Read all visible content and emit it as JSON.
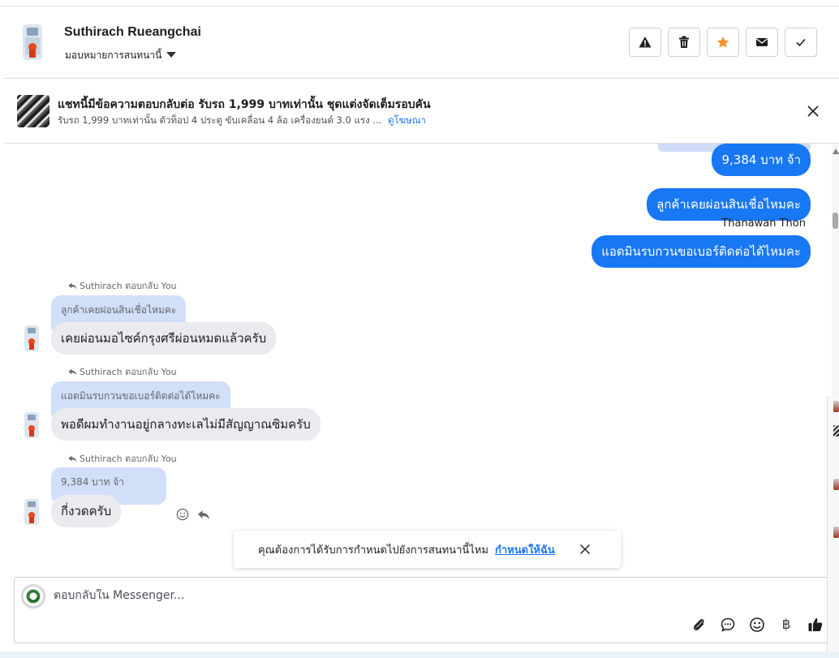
{
  "header": {
    "contact_name": "Suthirach Rueangchai",
    "assign_label": "มอบหมายการสนทนานี้",
    "actions": [
      {
        "name": "report-button",
        "icon": "warning-icon"
      },
      {
        "name": "delete-button",
        "icon": "trash-icon"
      },
      {
        "name": "star-button",
        "icon": "star-icon",
        "color": "#f0932b"
      },
      {
        "name": "mark-unread-button",
        "icon": "envelope-icon"
      },
      {
        "name": "mark-done-button",
        "icon": "check-icon"
      }
    ]
  },
  "ad_banner": {
    "title": "แชทนี้มีข้อความตอบกลับต่อ รับรถ 1,999 บาทเท่านั้น ชุดแต่งจัดเต็มรอบคัน",
    "subtitle": "รับรถ 1,999 บาทเท่านั้น ตัวท็อป 4 ประตู ขับเคลื่อน 4 ล้อ เครื่องยนต์ 3.0 แรง ...",
    "link": "ดูโฆษณา"
  },
  "conversation": {
    "outgoing": [
      {
        "text": "9,384 บาท จ้า"
      },
      {
        "text": "ลูกค้าเคยผ่อนสินเชื่อไหมคะ"
      },
      {
        "text": "แอดมินรบกวนขอเบอร์ติดต่อได้ไหมคะ"
      }
    ],
    "sender_label": "Thanawan Thon",
    "incoming": [
      {
        "reply_note": "Suthirach ตอบกลับ You",
        "quote": "ลูกค้าเคยผ่อนสินเชื่อไหมคะ",
        "text": "เคยผ่อนมอไซค์กรุงศรีผ่อนหมดแล้วครับ"
      },
      {
        "reply_note": "Suthirach ตอบกลับ You",
        "quote": "แอดมินรบกวนขอเบอร์ติดต่อได้ไหมคะ",
        "text": "พอดีผมทำงานอยู่กลางทะเลไม่มีสัญญาณซิมครับ"
      },
      {
        "reply_note": "Suthirach ตอบกลับ You",
        "quote": "9,384 บาท จ้า",
        "text": "กี่งวดครับ"
      }
    ]
  },
  "toast": {
    "text": "คุณต้องการได้รับการกำหนดไปยังการสนทนานี้ไหม",
    "link": "กำหนดให้ฉัน"
  },
  "composer": {
    "placeholder": "ตอบกลับใน Messenger...",
    "tools": [
      "paperclip-icon",
      "chat-bubble-icon",
      "emoji-icon",
      "baht-icon",
      "thumbs-up-icon"
    ],
    "currency_symbol": "฿"
  },
  "colors": {
    "outgoing_bubble": "#1877f2",
    "incoming_bubble": "#e9ebee",
    "quote_bubble": "#d1dff9",
    "link": "#1876f2"
  }
}
